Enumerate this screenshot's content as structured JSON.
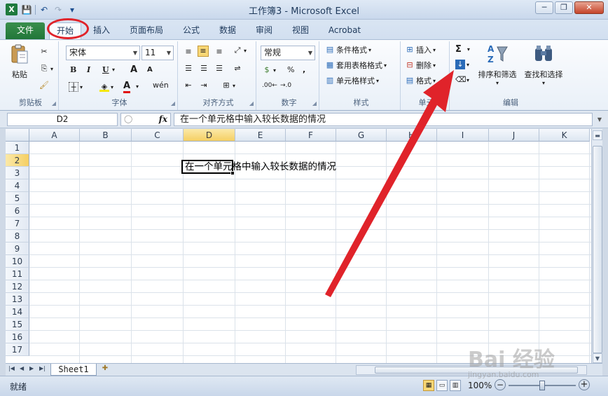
{
  "window": {
    "title": "工作簿3 - Microsoft Excel",
    "app_icon": "X",
    "controls": {
      "minimize": "─",
      "restore": "❐",
      "close": "✕"
    }
  },
  "quick_access": {
    "save_icon": "💾",
    "undo_icon": "↶",
    "redo_icon": "↷",
    "customize_icon": "▾"
  },
  "tabs": [
    {
      "label": "文件",
      "file": true
    },
    {
      "label": "开始",
      "active": true
    },
    {
      "label": "插入"
    },
    {
      "label": "页面布局"
    },
    {
      "label": "公式"
    },
    {
      "label": "数据"
    },
    {
      "label": "审阅"
    },
    {
      "label": "视图"
    },
    {
      "label": "Acrobat"
    }
  ],
  "ribbon": {
    "clipboard": {
      "paste": "粘贴",
      "label": "剪贴板"
    },
    "font": {
      "name": "宋体",
      "size": "11",
      "bold": "B",
      "italic": "I",
      "underline": "U",
      "grow": "A",
      "shrink": "A",
      "color_letter": "A",
      "pinyin": "wén",
      "label": "字体"
    },
    "alignment": {
      "label": "对齐方式"
    },
    "number": {
      "format": "常规",
      "percent": "%",
      "comma": ",",
      "label": "数字"
    },
    "styles": {
      "conditional": "条件格式",
      "table": "套用表格格式",
      "cell": "单元格样式",
      "label": "样式"
    },
    "cells": {
      "insert": "插入",
      "delete": "删除",
      "format": "格式",
      "label": "单元"
    },
    "editing": {
      "sum": "Σ",
      "sort": "排序和筛选",
      "find": "查找和选择",
      "label": "编辑"
    }
  },
  "formula_bar": {
    "name_box": "D2",
    "fx": "fx",
    "content": "在一个单元格中输入较长数据的情况"
  },
  "grid": {
    "columns": [
      "A",
      "B",
      "C",
      "D",
      "E",
      "F",
      "G",
      "H",
      "I",
      "J",
      "K"
    ],
    "rows": [
      "1",
      "2",
      "3",
      "4",
      "5",
      "6",
      "7",
      "8",
      "9",
      "10",
      "11",
      "12",
      "13",
      "14",
      "15",
      "16",
      "17"
    ],
    "selected_column": "D",
    "selected_row": "2",
    "active_cell_text": "在一个单元格中输入较长数据的情况"
  },
  "sheets": {
    "tabs": [
      "Sheet1"
    ]
  },
  "status": {
    "ready": "就绪",
    "zoom": "100%",
    "zoom_level_percent": 100
  },
  "colors": {
    "annotation_red": "#e0232a",
    "file_tab": "#217739",
    "selection_header": "#f5cf63"
  },
  "watermark": {
    "text": "Bai 经验",
    "url": "jingyan.baidu.com"
  }
}
